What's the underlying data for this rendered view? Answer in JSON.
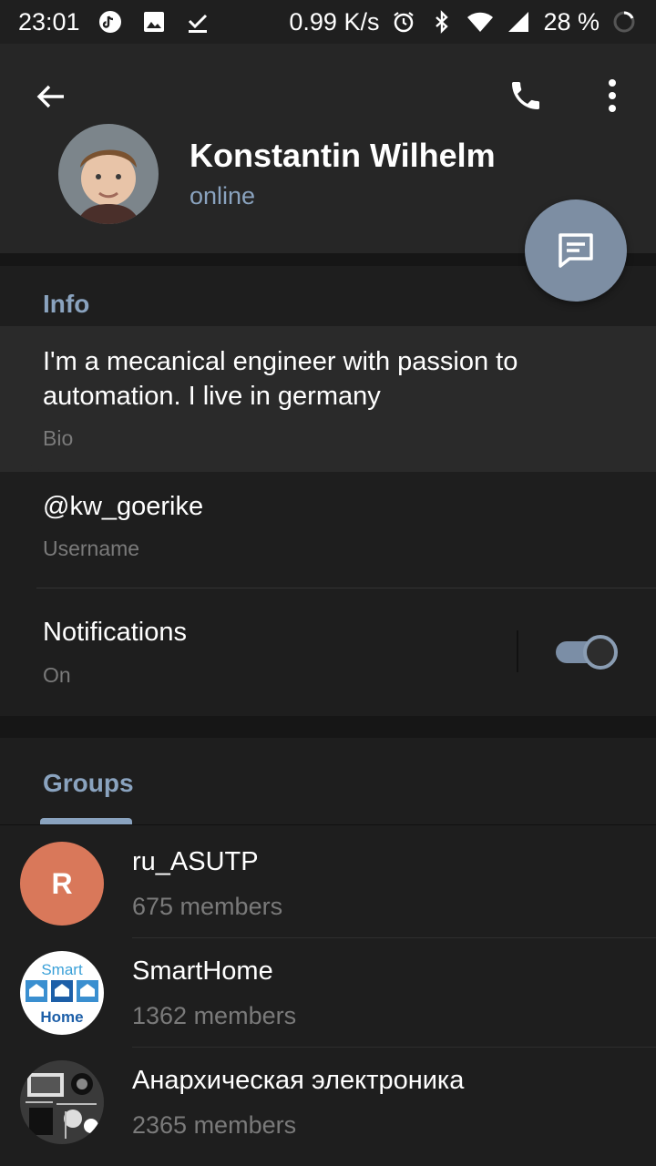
{
  "status_bar": {
    "time": "23:01",
    "network_speed": "0.99 K/s",
    "battery": "28 %",
    "icons": [
      "tiktok-icon",
      "image-icon",
      "download-done-icon",
      "alarm-icon",
      "bluetooth-icon",
      "wifi-icon",
      "signal-icon",
      "battery-ring-icon"
    ]
  },
  "header": {
    "name": "Konstantin Wilhelm",
    "status": "online",
    "back_icon": "arrow-back-icon",
    "call_icon": "phone-icon",
    "more_icon": "more-vertical-icon",
    "fab_icon": "message-icon"
  },
  "info": {
    "title": "Info",
    "bio": "I'm a mecanical engineer with passion to automation. I live in germany",
    "bio_label": "Bio",
    "username": "@kw_goerike",
    "username_label": "Username",
    "notifications": "Notifications",
    "notifications_state": "On",
    "notifications_enabled": true
  },
  "groups": {
    "title": "Groups",
    "items": [
      {
        "name": "ru_ASUTP",
        "members": "675 members",
        "avatar_letter": "R",
        "avatar_color": "#d9785a"
      },
      {
        "name": "SmartHome",
        "members": "1362 members",
        "avatar_text_top": "Smart",
        "avatar_text_bottom": "Home"
      },
      {
        "name": "Анархическая электроника",
        "members": "2365 members"
      }
    ]
  },
  "colors": {
    "accent": "#8aa3bf",
    "fab": "#7d8ea3",
    "background": "#1e1e1e"
  }
}
